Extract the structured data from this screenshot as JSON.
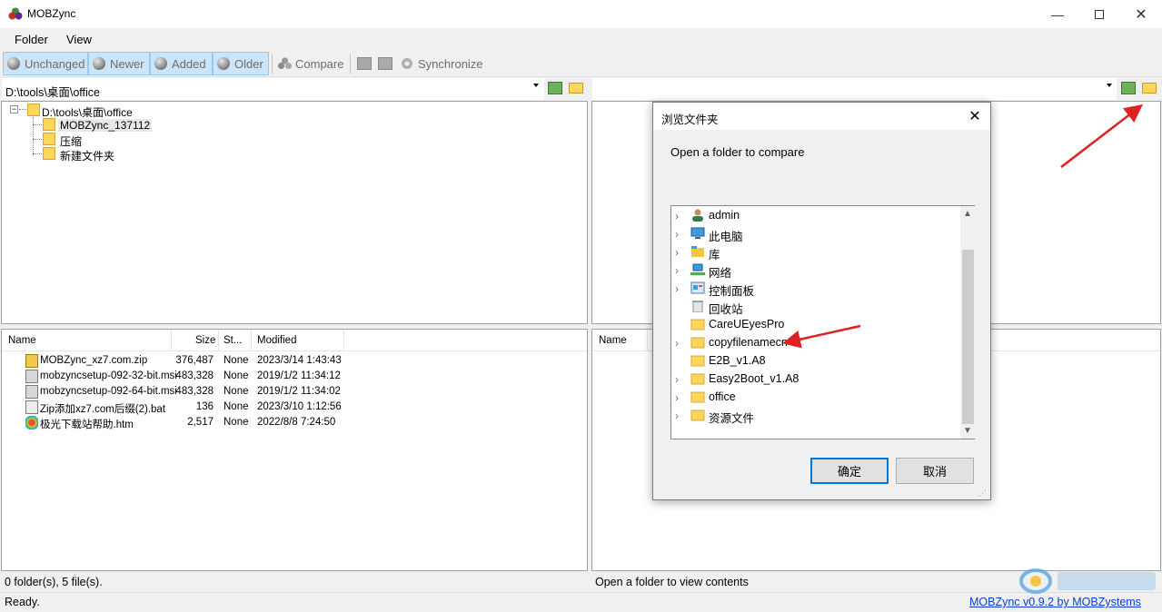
{
  "window": {
    "title": "MOBZync"
  },
  "menu": {
    "items": [
      "Folder",
      "View"
    ]
  },
  "toolbar": {
    "unchanged": "Unchanged",
    "newer": "Newer",
    "added": "Added",
    "older": "Older",
    "compare": "Compare",
    "synchronize": "Synchronize"
  },
  "left": {
    "path": "D:\\tools\\桌面\\office",
    "tree": {
      "root": "D:\\tools\\桌面\\office",
      "children": [
        "MOBZync_137112",
        "压缩",
        "新建文件夹"
      ]
    },
    "list": {
      "headers": {
        "name": "Name",
        "size": "Size",
        "status": "St...",
        "modified": "Modified"
      },
      "rows": [
        {
          "name": "MOBZync_xz7.com.zip",
          "size": "376,487",
          "status": "None",
          "modified": "2023/3/14 1:43:43",
          "icon": "zip-icon"
        },
        {
          "name": "mobzyncsetup-092-32-bit.msi",
          "size": "483,328",
          "status": "None",
          "modified": "2019/1/2 11:34:12",
          "icon": "msi-icon"
        },
        {
          "name": "mobzyncsetup-092-64-bit.msi",
          "size": "483,328",
          "status": "None",
          "modified": "2019/1/2 11:34:02",
          "icon": "msi-icon"
        },
        {
          "name": "Zip添加xz7.com后缀(2).bat",
          "size": "136",
          "status": "None",
          "modified": "2023/3/10 1:12:56",
          "icon": "bat-icon"
        },
        {
          "name": "极光下载站帮助.htm",
          "size": "2,517",
          "status": "None",
          "modified": "2022/8/8 7:24:50",
          "icon": "htm-icon"
        }
      ]
    },
    "status": "0 folder(s), 5 file(s)."
  },
  "right": {
    "path": "",
    "list": {
      "headers": {
        "name": "Name"
      }
    },
    "status": "Open a folder to view contents"
  },
  "statusbar": {
    "ready": "Ready.",
    "link": "MOBZync v0.9.2 by MOBZystems"
  },
  "dialog": {
    "title": "浏览文件夹",
    "description": "Open a folder to compare",
    "items": [
      {
        "label": "admin",
        "icon": "user-icon",
        "expandable": true
      },
      {
        "label": "此电脑",
        "icon": "computer-icon",
        "expandable": true
      },
      {
        "label": "库",
        "icon": "library-icon",
        "expandable": true
      },
      {
        "label": "网络",
        "icon": "network-icon",
        "expandable": true
      },
      {
        "label": "控制面板",
        "icon": "control-panel-icon",
        "expandable": true
      },
      {
        "label": "回收站",
        "icon": "recycle-bin-icon",
        "expandable": false
      },
      {
        "label": "CareUEyesPro",
        "icon": "folder-icon",
        "expandable": false
      },
      {
        "label": "copyfilenamecn",
        "icon": "folder-icon",
        "expandable": true
      },
      {
        "label": "E2B_v1.A8",
        "icon": "folder-icon",
        "expandable": false
      },
      {
        "label": "Easy2Boot_v1.A8",
        "icon": "folder-icon",
        "expandable": true
      },
      {
        "label": "office",
        "icon": "folder-icon",
        "expandable": true
      },
      {
        "label": "资源文件",
        "icon": "folder-icon",
        "expandable": true
      }
    ],
    "ok": "确定",
    "cancel": "取消"
  },
  "colors": {
    "toggle_bg": "#cce4f7",
    "toggle_border": "#99c9ef",
    "ok_border": "#0078d7",
    "link": "#0b3bd6",
    "arrow": "#e02020"
  }
}
